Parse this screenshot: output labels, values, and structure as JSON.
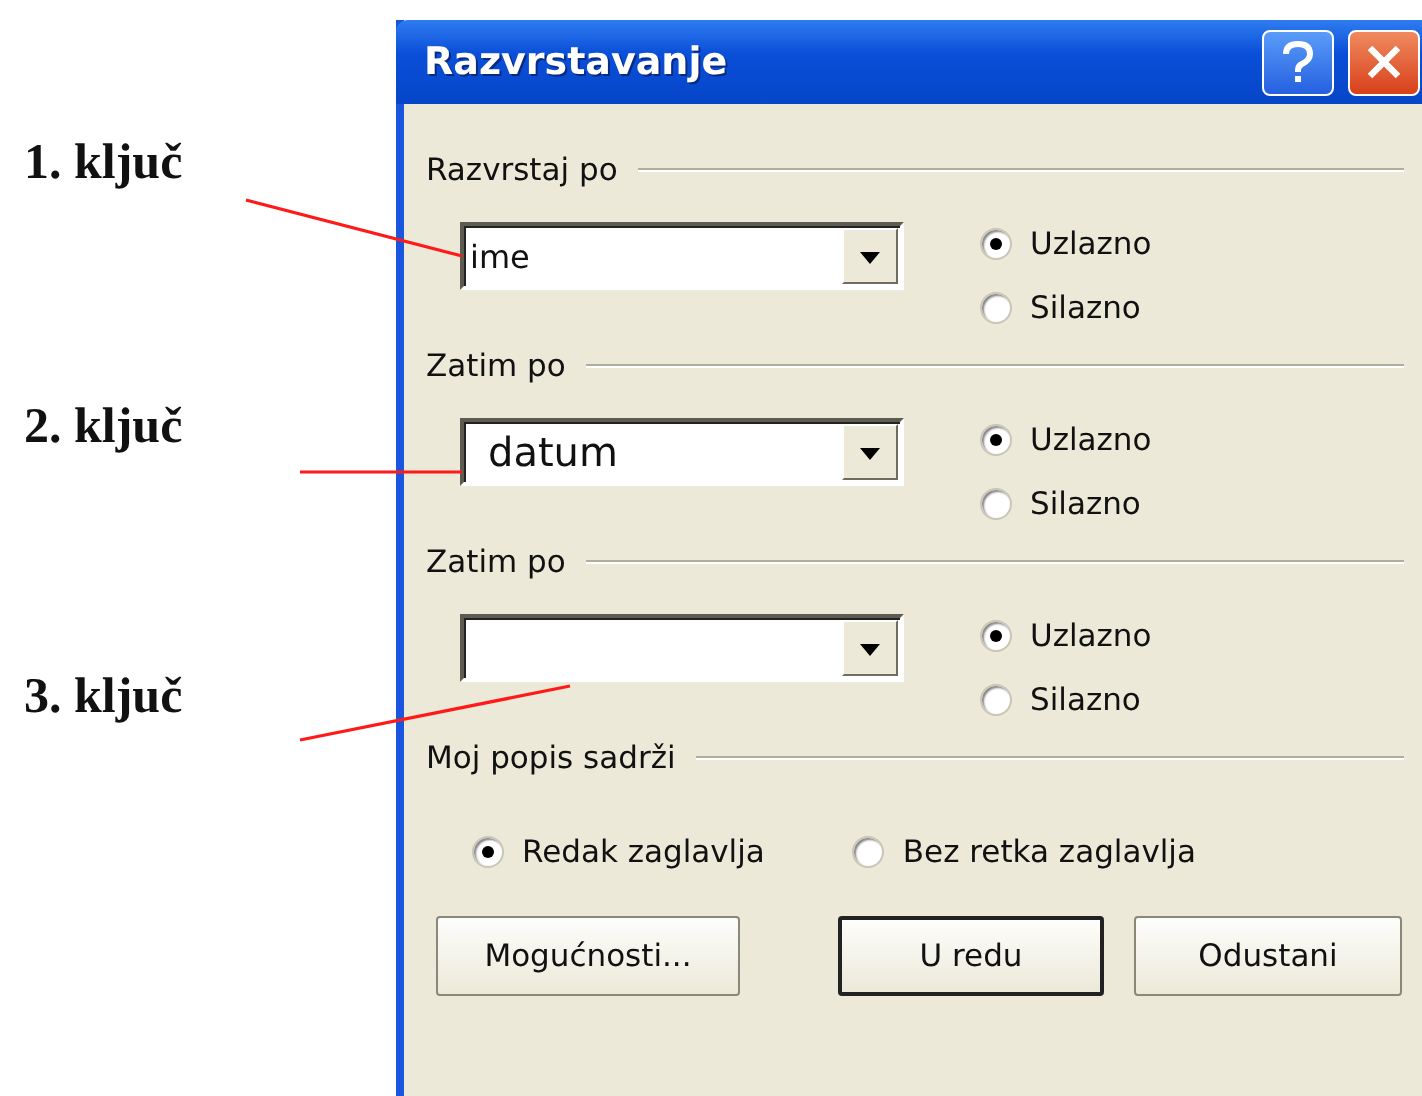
{
  "annotations": [
    {
      "label": "1. ključ"
    },
    {
      "label": "2. ključ"
    },
    {
      "label": "3. ključ"
    }
  ],
  "window": {
    "title": "Razvrstavanje"
  },
  "sort_groups": [
    {
      "title": "Razvrstaj po",
      "value": "ime",
      "options": [
        {
          "label": "Uzlazno",
          "selected": true
        },
        {
          "label": "Silazno",
          "selected": false
        }
      ]
    },
    {
      "title": "Zatim po",
      "value": "datum",
      "options": [
        {
          "label": "Uzlazno",
          "selected": true
        },
        {
          "label": "Silazno",
          "selected": false
        }
      ]
    },
    {
      "title": "Zatim po",
      "options": [
        {
          "label": "Uzlazno",
          "selected": true
        },
        {
          "label": "Silazno",
          "selected": false
        }
      ]
    }
  ],
  "list_header": {
    "title": "Moj popis sadrži",
    "options": [
      {
        "label": "Redak zaglavlja",
        "selected": true
      },
      {
        "label": "Bez retka zaglavlja",
        "selected": false
      }
    ]
  },
  "buttons": [
    {
      "label": "Mogućnosti...",
      "default": false
    },
    {
      "label": "U redu",
      "default": true
    },
    {
      "label": "Odustani",
      "default": false
    }
  ]
}
